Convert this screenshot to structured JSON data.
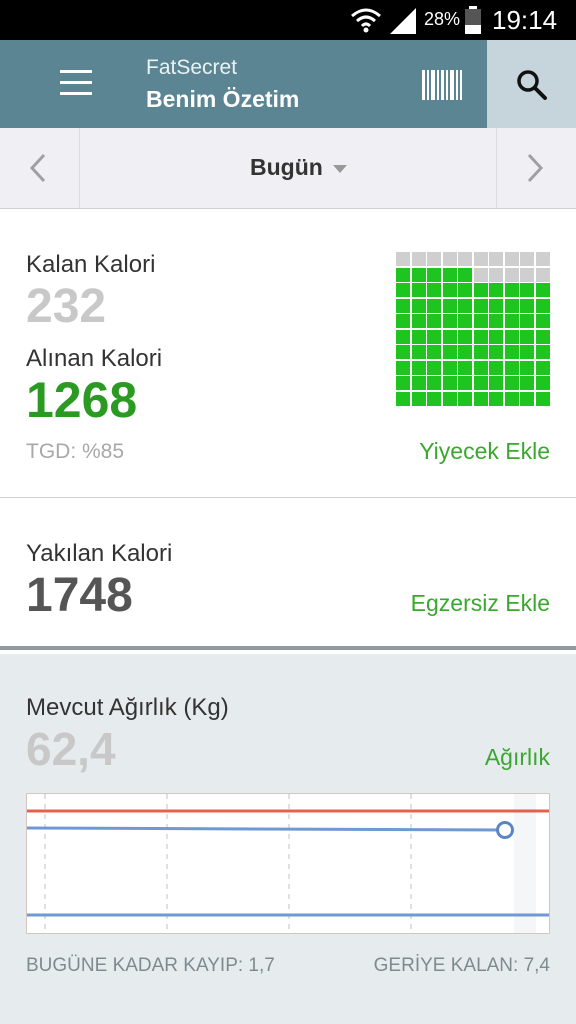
{
  "status_bar": {
    "battery_percent": "28%",
    "time": "19:14",
    "icons": [
      "wifi-icon",
      "signal-icon",
      "battery-icon"
    ]
  },
  "app_bar": {
    "app_name": "FatSecret",
    "title": "Benim Özetim",
    "icons": [
      "menu-icon",
      "barcode-icon",
      "search-icon"
    ]
  },
  "date_nav": {
    "selected": "Bugün",
    "icons": [
      "chevron-left-icon",
      "caret-down-icon",
      "chevron-right-icon"
    ]
  },
  "calories": {
    "remaining_label": "Kalan Kalori",
    "remaining_value": "232",
    "consumed_label": "Alınan Kalori",
    "consumed_value": "1268",
    "rdi_text": "TGD: %85",
    "rdi_fraction": 0.85,
    "add_food_link": "Yiyecek Ekle"
  },
  "exercise": {
    "burned_label": "Yakılan Kalori",
    "burned_value": "1748",
    "add_exercise_link": "Egzersiz Ekle"
  },
  "weight": {
    "label": "Mevcut Ağırlık (Kg)",
    "value": "62,4",
    "link": "Ağırlık",
    "lost_text": "BUGÜNE KADAR KAYIP: 1,7",
    "remaining_text": "GERİYE KALAN: 7,4"
  },
  "colors": {
    "app_bar": "#5b8593",
    "accent_green": "#3aa82f",
    "consumed_green": "#2a9a23",
    "waffle_on": "#1fc51f",
    "waffle_off": "#cfcfcf",
    "chart_start_line": "#e4604f",
    "chart_line": "#6f99d2"
  }
}
